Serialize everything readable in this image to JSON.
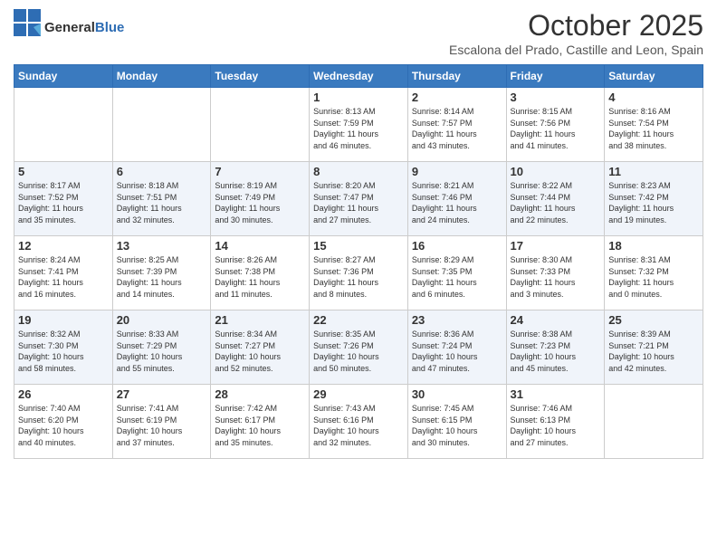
{
  "logo": {
    "general": "General",
    "blue": "Blue"
  },
  "title": "October 2025",
  "location": "Escalona del Prado, Castille and Leon, Spain",
  "days_of_week": [
    "Sunday",
    "Monday",
    "Tuesday",
    "Wednesday",
    "Thursday",
    "Friday",
    "Saturday"
  ],
  "weeks": [
    [
      {
        "day": "",
        "content": ""
      },
      {
        "day": "",
        "content": ""
      },
      {
        "day": "",
        "content": ""
      },
      {
        "day": "1",
        "content": "Sunrise: 8:13 AM\nSunset: 7:59 PM\nDaylight: 11 hours\nand 46 minutes."
      },
      {
        "day": "2",
        "content": "Sunrise: 8:14 AM\nSunset: 7:57 PM\nDaylight: 11 hours\nand 43 minutes."
      },
      {
        "day": "3",
        "content": "Sunrise: 8:15 AM\nSunset: 7:56 PM\nDaylight: 11 hours\nand 41 minutes."
      },
      {
        "day": "4",
        "content": "Sunrise: 8:16 AM\nSunset: 7:54 PM\nDaylight: 11 hours\nand 38 minutes."
      }
    ],
    [
      {
        "day": "5",
        "content": "Sunrise: 8:17 AM\nSunset: 7:52 PM\nDaylight: 11 hours\nand 35 minutes."
      },
      {
        "day": "6",
        "content": "Sunrise: 8:18 AM\nSunset: 7:51 PM\nDaylight: 11 hours\nand 32 minutes."
      },
      {
        "day": "7",
        "content": "Sunrise: 8:19 AM\nSunset: 7:49 PM\nDaylight: 11 hours\nand 30 minutes."
      },
      {
        "day": "8",
        "content": "Sunrise: 8:20 AM\nSunset: 7:47 PM\nDaylight: 11 hours\nand 27 minutes."
      },
      {
        "day": "9",
        "content": "Sunrise: 8:21 AM\nSunset: 7:46 PM\nDaylight: 11 hours\nand 24 minutes."
      },
      {
        "day": "10",
        "content": "Sunrise: 8:22 AM\nSunset: 7:44 PM\nDaylight: 11 hours\nand 22 minutes."
      },
      {
        "day": "11",
        "content": "Sunrise: 8:23 AM\nSunset: 7:42 PM\nDaylight: 11 hours\nand 19 minutes."
      }
    ],
    [
      {
        "day": "12",
        "content": "Sunrise: 8:24 AM\nSunset: 7:41 PM\nDaylight: 11 hours\nand 16 minutes."
      },
      {
        "day": "13",
        "content": "Sunrise: 8:25 AM\nSunset: 7:39 PM\nDaylight: 11 hours\nand 14 minutes."
      },
      {
        "day": "14",
        "content": "Sunrise: 8:26 AM\nSunset: 7:38 PM\nDaylight: 11 hours\nand 11 minutes."
      },
      {
        "day": "15",
        "content": "Sunrise: 8:27 AM\nSunset: 7:36 PM\nDaylight: 11 hours\nand 8 minutes."
      },
      {
        "day": "16",
        "content": "Sunrise: 8:29 AM\nSunset: 7:35 PM\nDaylight: 11 hours\nand 6 minutes."
      },
      {
        "day": "17",
        "content": "Sunrise: 8:30 AM\nSunset: 7:33 PM\nDaylight: 11 hours\nand 3 minutes."
      },
      {
        "day": "18",
        "content": "Sunrise: 8:31 AM\nSunset: 7:32 PM\nDaylight: 11 hours\nand 0 minutes."
      }
    ],
    [
      {
        "day": "19",
        "content": "Sunrise: 8:32 AM\nSunset: 7:30 PM\nDaylight: 10 hours\nand 58 minutes."
      },
      {
        "day": "20",
        "content": "Sunrise: 8:33 AM\nSunset: 7:29 PM\nDaylight: 10 hours\nand 55 minutes."
      },
      {
        "day": "21",
        "content": "Sunrise: 8:34 AM\nSunset: 7:27 PM\nDaylight: 10 hours\nand 52 minutes."
      },
      {
        "day": "22",
        "content": "Sunrise: 8:35 AM\nSunset: 7:26 PM\nDaylight: 10 hours\nand 50 minutes."
      },
      {
        "day": "23",
        "content": "Sunrise: 8:36 AM\nSunset: 7:24 PM\nDaylight: 10 hours\nand 47 minutes."
      },
      {
        "day": "24",
        "content": "Sunrise: 8:38 AM\nSunset: 7:23 PM\nDaylight: 10 hours\nand 45 minutes."
      },
      {
        "day": "25",
        "content": "Sunrise: 8:39 AM\nSunset: 7:21 PM\nDaylight: 10 hours\nand 42 minutes."
      }
    ],
    [
      {
        "day": "26",
        "content": "Sunrise: 7:40 AM\nSunset: 6:20 PM\nDaylight: 10 hours\nand 40 minutes."
      },
      {
        "day": "27",
        "content": "Sunrise: 7:41 AM\nSunset: 6:19 PM\nDaylight: 10 hours\nand 37 minutes."
      },
      {
        "day": "28",
        "content": "Sunrise: 7:42 AM\nSunset: 6:17 PM\nDaylight: 10 hours\nand 35 minutes."
      },
      {
        "day": "29",
        "content": "Sunrise: 7:43 AM\nSunset: 6:16 PM\nDaylight: 10 hours\nand 32 minutes."
      },
      {
        "day": "30",
        "content": "Sunrise: 7:45 AM\nSunset: 6:15 PM\nDaylight: 10 hours\nand 30 minutes."
      },
      {
        "day": "31",
        "content": "Sunrise: 7:46 AM\nSunset: 6:13 PM\nDaylight: 10 hours\nand 27 minutes."
      },
      {
        "day": "",
        "content": ""
      }
    ]
  ]
}
